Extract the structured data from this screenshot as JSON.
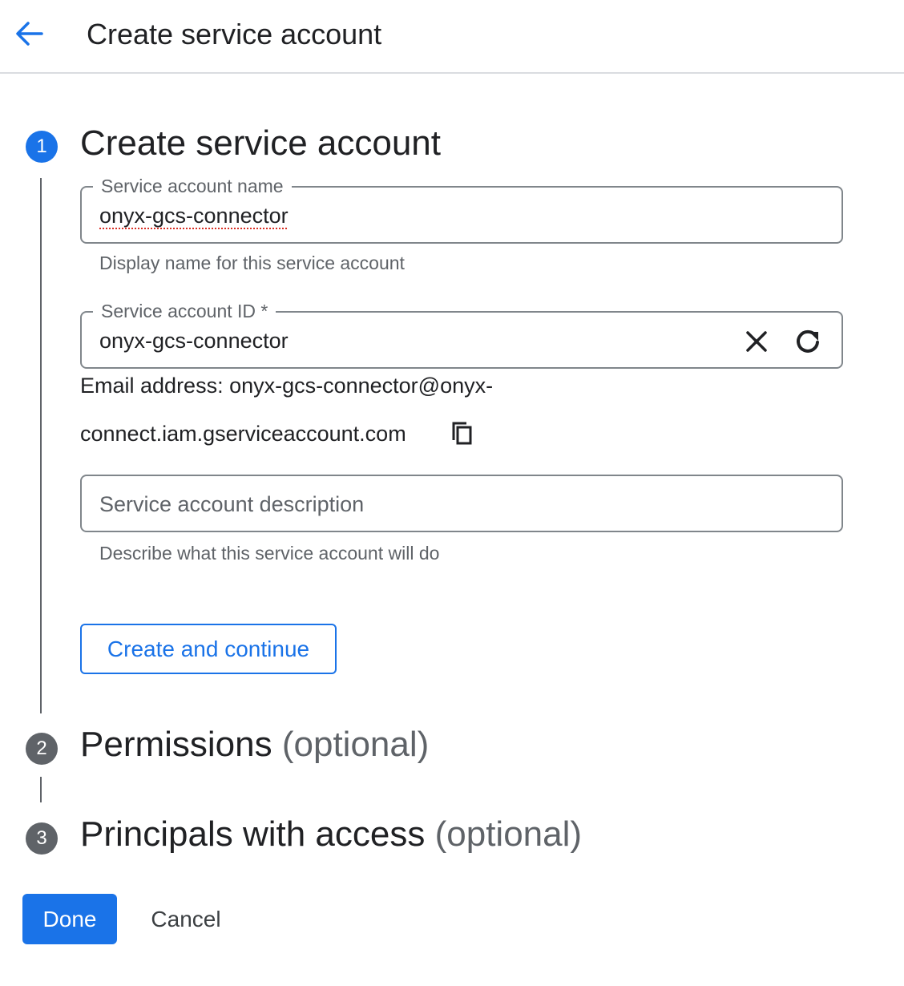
{
  "header": {
    "title": "Create service account",
    "back_icon": "arrow-back-icon"
  },
  "steps": [
    {
      "number": "1",
      "title": "Create service account",
      "optional": ""
    },
    {
      "number": "2",
      "title": "Permissions",
      "optional": "(optional)"
    },
    {
      "number": "3",
      "title": "Principals with access",
      "optional": "(optional)"
    }
  ],
  "form": {
    "name_field": {
      "label": "Service account name",
      "value": "onyx-gcs-connector",
      "hint": "Display name for this service account"
    },
    "id_field": {
      "label": "Service account ID *",
      "value": "onyx-gcs-connector",
      "clear_icon": "close-icon",
      "refresh_icon": "refresh-icon"
    },
    "email": {
      "line1": "Email address: onyx-gcs-connector@onyx-",
      "line2": "connect.iam.gserviceaccount.com",
      "copy_icon": "copy-icon"
    },
    "description_field": {
      "placeholder": "Service account description",
      "value": "",
      "hint": "Describe what this service account will do"
    },
    "create_button_label": "Create and continue"
  },
  "footer": {
    "done_label": "Done",
    "cancel_label": "Cancel"
  },
  "colors": {
    "accent": "#1a73e8",
    "step_inactive": "#5f6368",
    "text_primary": "#202124",
    "text_secondary": "#5f6368",
    "outline": "#80868b"
  }
}
